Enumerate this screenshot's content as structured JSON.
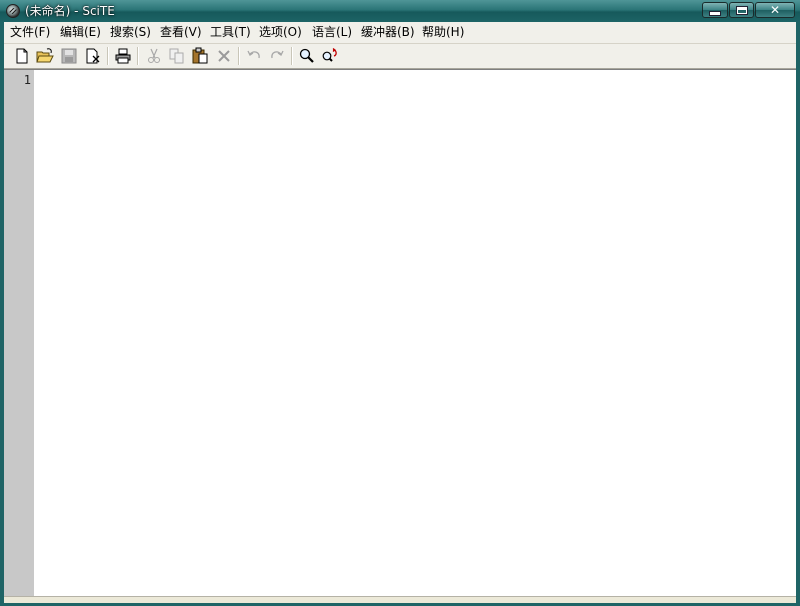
{
  "window": {
    "title": "(未命名) - SciTE",
    "controls": {
      "minimize": "minimize",
      "maximize": "maximize",
      "close": "close"
    }
  },
  "menu": {
    "items": [
      {
        "label": "文件(F)"
      },
      {
        "label": "编辑(E)"
      },
      {
        "label": "搜索(S)"
      },
      {
        "label": "查看(V)"
      },
      {
        "label": "工具(T)"
      },
      {
        "label": "选项(O)"
      },
      {
        "label": "语言(L)"
      },
      {
        "label": "缓冲器(B)"
      },
      {
        "label": "帮助(H)"
      }
    ]
  },
  "toolbar": {
    "buttons": [
      {
        "icon": "new-file-icon",
        "enabled": true
      },
      {
        "icon": "open-folder-icon",
        "enabled": true
      },
      {
        "icon": "save-icon",
        "enabled": false
      },
      {
        "icon": "close-file-icon",
        "enabled": true
      },
      {
        "icon": "print-icon",
        "enabled": true
      },
      {
        "icon": "cut-icon",
        "enabled": false
      },
      {
        "icon": "copy-icon",
        "enabled": false
      },
      {
        "icon": "paste-icon",
        "enabled": true
      },
      {
        "icon": "delete-icon",
        "enabled": false
      },
      {
        "icon": "undo-icon",
        "enabled": false
      },
      {
        "icon": "redo-icon",
        "enabled": false
      },
      {
        "icon": "find-icon",
        "enabled": true
      },
      {
        "icon": "replace-icon",
        "enabled": true
      }
    ]
  },
  "editor": {
    "line_numbers": [
      "1"
    ],
    "content": ""
  },
  "colors": {
    "title_bar": "#1d6466",
    "gutter": "#c8c8c8",
    "editor_bg": "#ffffff"
  }
}
